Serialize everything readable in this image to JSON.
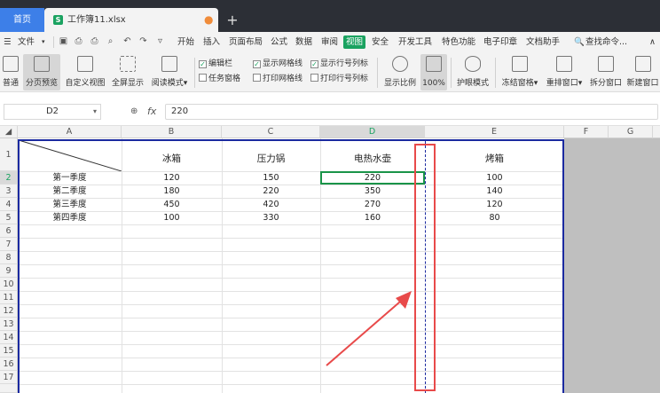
{
  "tabs": {
    "home": "首页",
    "file_icon": "S",
    "file_name": "工作簿11.xlsx",
    "new_tab": "+"
  },
  "menu": {
    "file": "文件",
    "items": [
      "开始",
      "插入",
      "页面布局",
      "公式",
      "数据",
      "审阅",
      "视图",
      "安全",
      "开发工具",
      "特色功能",
      "电子印章",
      "文档助手"
    ],
    "active": "视图",
    "search": "查找命令..."
  },
  "ribbon": {
    "normal": "普通",
    "page_break_preview": "分页预览",
    "custom_view": "自定义视图",
    "full_screen": "全屏显示",
    "reading_mode": "阅读模式",
    "edit_bar": "编辑栏",
    "task_pane": "任务窗格",
    "show_gridlines": "显示网格线",
    "print_gridlines": "打印网格线",
    "show_headers": "显示行号列标",
    "print_headers": "打印行号列标",
    "zoom": "显示比例",
    "zoom100": "100%",
    "eye_mode": "护眼模式",
    "freeze": "冻结窗格",
    "arrange": "重排窗口",
    "split": "拆分窗口",
    "new_window": "新建窗口"
  },
  "formula": {
    "cell_ref": "D2",
    "fx": "fx",
    "value": "220"
  },
  "columns": [
    "A",
    "B",
    "C",
    "D",
    "E",
    "F",
    "G"
  ],
  "rows": [
    "1",
    "2",
    "3",
    "4",
    "5",
    "6",
    "7",
    "8",
    "9",
    "10",
    "11",
    "12",
    "13",
    "14",
    "15",
    "16",
    "17"
  ],
  "table": {
    "headers": [
      "冰箱",
      "压力锅",
      "电热水壶",
      "烤箱"
    ],
    "data": [
      [
        "第一季度",
        "120",
        "150",
        "220",
        "100"
      ],
      [
        "第二季度",
        "180",
        "220",
        "350",
        "140"
      ],
      [
        "第三季度",
        "450",
        "420",
        "270",
        "120"
      ],
      [
        "第四季度",
        "100",
        "330",
        "160",
        "80"
      ]
    ]
  },
  "colors": {
    "accent": "#1aa260",
    "page_border": "#1b2aa0",
    "annotation": "#e84a4a"
  }
}
